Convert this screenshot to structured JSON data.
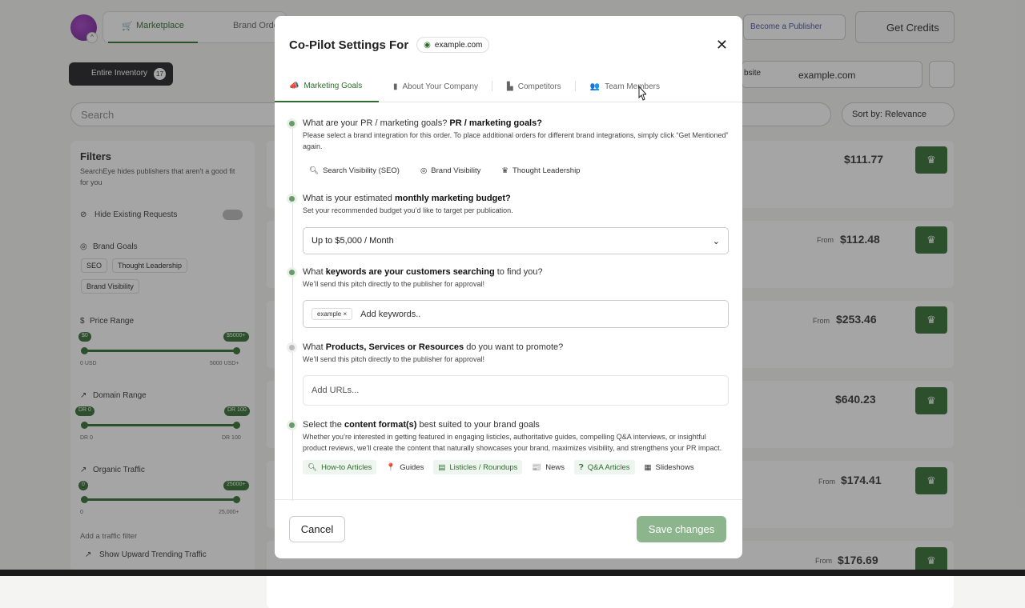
{
  "background": {
    "nav": {
      "marketplace": "Marketplace",
      "brand_orders": "Brand Orde",
      "become_publisher": "Become a Publisher",
      "get_credits": "Get Credits"
    },
    "inventory": {
      "label": "Entire Inventory",
      "count": "17"
    },
    "website_label": "bsite",
    "website_value": "example.com",
    "search_placeholder": "Search",
    "sort_label": "Sort by: Relevance",
    "filters": {
      "title": "Filters",
      "subtitle": "SearchEye hides publishers that aren't a good fit for you",
      "hide_existing": "Hide Existing Requests",
      "brand_goals": "Brand Goals",
      "goal_chips": [
        "SEO",
        "Thought Leadership",
        "Brand Visibility"
      ],
      "price_range": "Price Range",
      "price_min_chip": "$0",
      "price_max_chip": "$5000+",
      "price_min_label": "0 USD",
      "price_max_label": "5000 USD+",
      "domain_range": "Domain Range",
      "dr_min_chip": "DR 0",
      "dr_max_chip": "DR 100",
      "dr_min_label": "DR 0",
      "dr_max_label": "DR 100",
      "organic_traffic": "Organic Traffic",
      "ot_min_chip": "0",
      "ot_max_chip": "25000+",
      "ot_min_label": "0",
      "ot_max_label": "25,000+",
      "add_traffic": "Add a traffic filter",
      "upward": "Show Upward Trending Traffic"
    },
    "cards": [
      {
        "from": "",
        "price": "$111.77"
      },
      {
        "from": "From",
        "price": "$112.48"
      },
      {
        "from": "From",
        "price": "$253.46"
      },
      {
        "from": "",
        "price": "$640.23"
      },
      {
        "from": "From",
        "price": "$174.41"
      },
      {
        "from": "From",
        "price": "$176.69"
      }
    ]
  },
  "modal": {
    "title": "Co-Pilot Settings For",
    "site": "example.com",
    "tabs": [
      "Marketing Goals",
      "About Your Company",
      "Competitors",
      "Team Members"
    ],
    "q1": {
      "pre": "What are your PR / marketing goals? ",
      "bold": "PR / marketing goals?",
      "desc": "Please select a brand integration for this order. To place additional orders for different brand integrations, simply click “Get Mentioned” again."
    },
    "goals": [
      "Search Visibility (SEO)",
      "Brand Visibility",
      "Thought Leadership"
    ],
    "q2": {
      "pre": "What is your estimated ",
      "bold": "monthly marketing budget?",
      "desc": "Set your recommended budget you’d like to target per publication."
    },
    "budget": "Up to $5,000 / Month",
    "q3": {
      "pre": "What ",
      "bold": "keywords are your customers searching",
      "post": " to find you?",
      "desc": "We’ll send this pitch directly to the publisher for approval!"
    },
    "keyword_chip": "example ×",
    "keyword_placeholder": "Add keywords..",
    "q4": {
      "pre": "What ",
      "bold": "Products, Services or Resources",
      "post": " do you want to promote?",
      "desc": "We’ll send this pitch directly to the publisher for approval!"
    },
    "url_placeholder": "Add URLs...",
    "q5": {
      "pre": "Select the ",
      "bold": "content format(s)",
      "post": " best suited to your brand goals",
      "desc": "Whether you’re interested in getting featured in engaging listicles, authoritative guides, compelling Q&A interviews, or insightful product reviews, we’ll create the content that naturally showcases your brand, maximizes visibility, and strengthens your PR impact."
    },
    "formats": [
      {
        "label": "How-to Articles",
        "selected": true
      },
      {
        "label": "Guides",
        "selected": false
      },
      {
        "label": "Listicles / Roundups",
        "selected": true
      },
      {
        "label": "News",
        "selected": false
      },
      {
        "label": "Q&A Articles",
        "selected": true
      },
      {
        "label": "Slideshows",
        "selected": false
      }
    ],
    "cancel": "Cancel",
    "save": "Save changes"
  },
  "colors": {
    "accent": "#2f6b2f",
    "save_disabled": "#8db58d"
  }
}
